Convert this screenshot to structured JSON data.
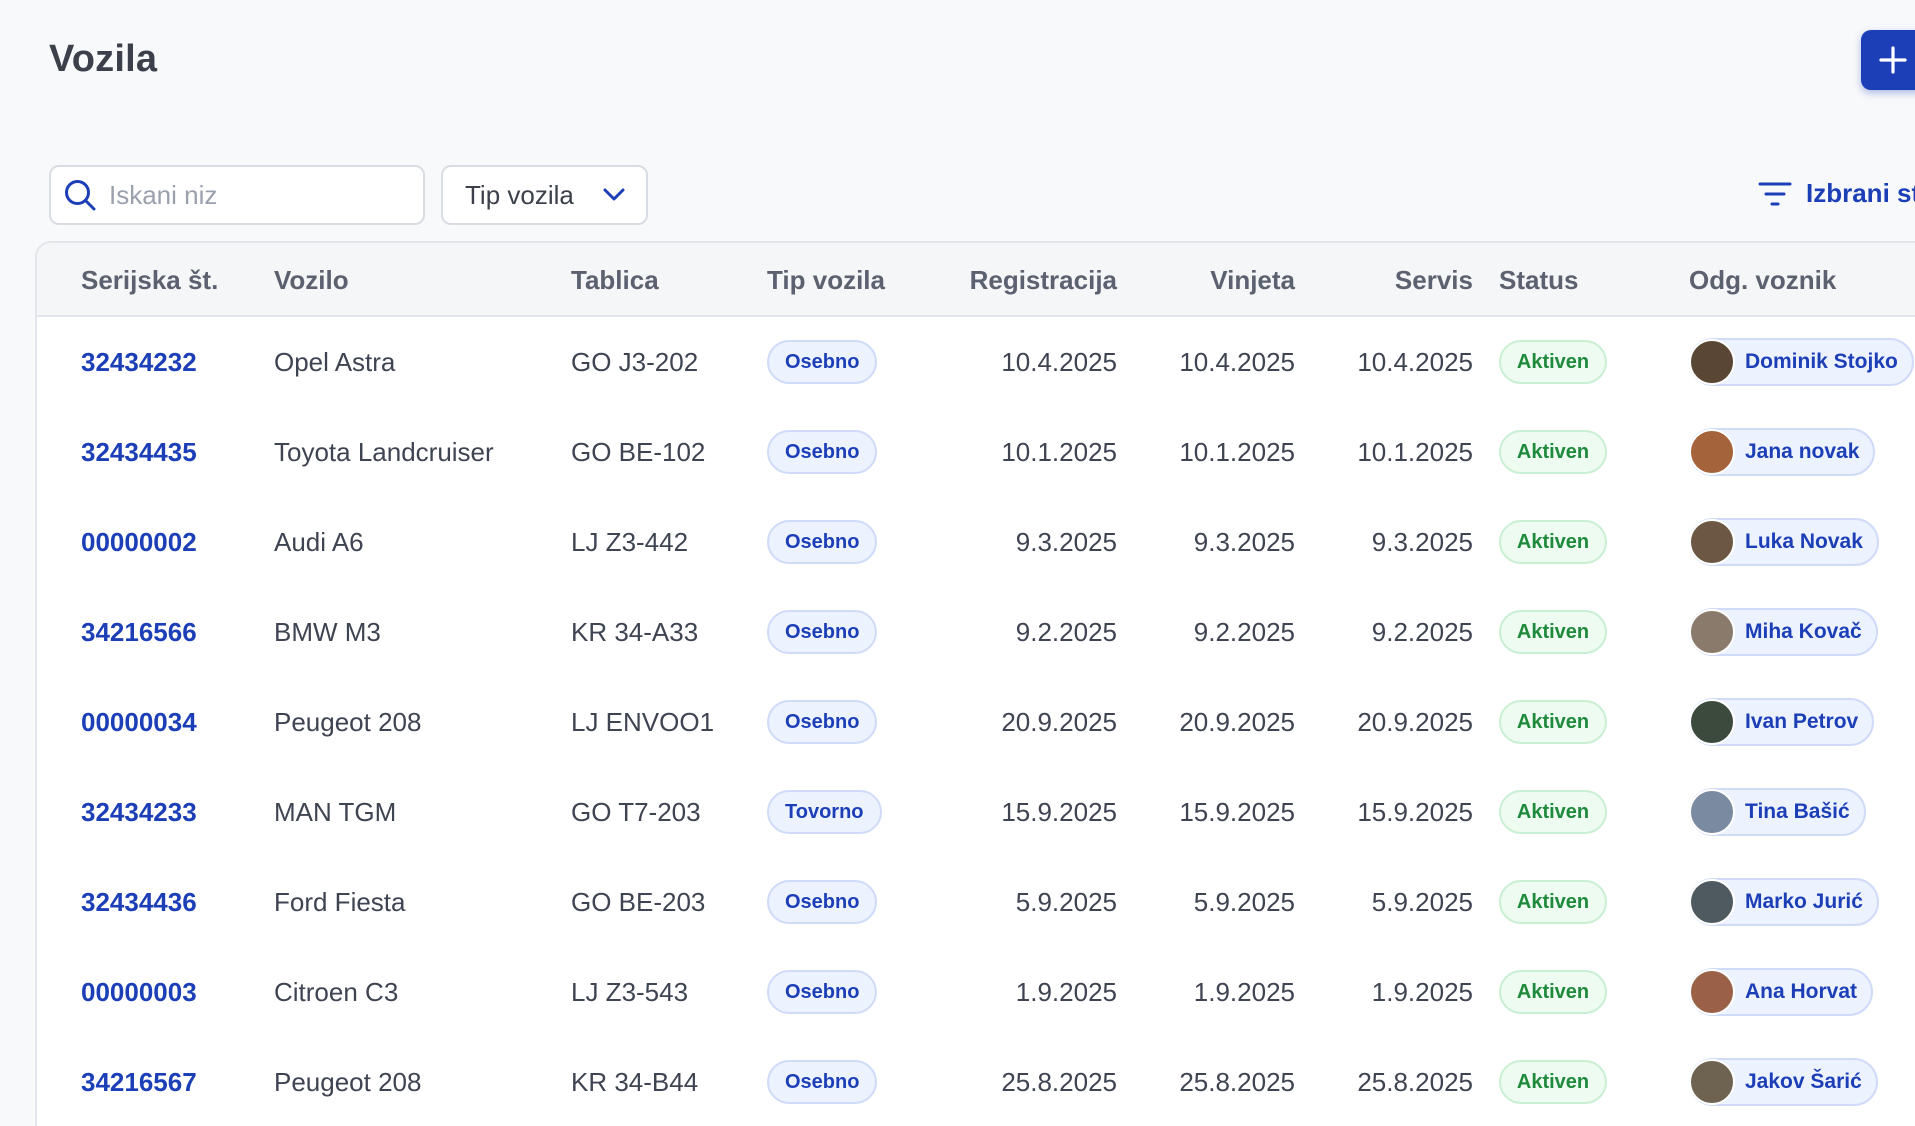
{
  "header": {
    "title": "Vozila",
    "add_button_icon": "plus-icon"
  },
  "toolbar": {
    "search_placeholder": "Iskani niz",
    "search_value": "",
    "type_filter_label": "Tip vozila",
    "columns_label": "Izbrani st"
  },
  "table": {
    "columns": {
      "serial": "Serijska št.",
      "vehicle": "Vozilo",
      "plate": "Tablica",
      "type": "Tip vozila",
      "registration": "Registracija",
      "vignette": "Vinjeta",
      "service": "Servis",
      "status": "Status",
      "driver": "Odg. voznik"
    },
    "rows": [
      {
        "serial": "32434232",
        "vehicle": "Opel Astra",
        "plate": "GO J3-202",
        "type": "Osebno",
        "registration": "10.4.2025",
        "vignette": "10.4.2025",
        "service": "10.4.2025",
        "status": "Aktiven",
        "driver": "Dominik Stojko",
        "avatar_color": "#5a4634"
      },
      {
        "serial": "32434435",
        "vehicle": "Toyota Landcruiser",
        "plate": "GO BE-102",
        "type": "Osebno",
        "registration": "10.1.2025",
        "vignette": "10.1.2025",
        "service": "10.1.2025",
        "status": "Aktiven",
        "driver": "Jana novak",
        "avatar_color": "#a5633c"
      },
      {
        "serial": "00000002",
        "vehicle": "Audi A6",
        "plate": "LJ Z3-442",
        "type": "Osebno",
        "registration": "9.3.2025",
        "vignette": "9.3.2025",
        "service": "9.3.2025",
        "status": "Aktiven",
        "driver": "Luka Novak",
        "avatar_color": "#6b5744"
      },
      {
        "serial": "34216566",
        "vehicle": "BMW M3",
        "plate": "KR 34-A33",
        "type": "Osebno",
        "registration": "9.2.2025",
        "vignette": "9.2.2025",
        "service": "9.2.2025",
        "status": "Aktiven",
        "driver": "Miha Kovač",
        "avatar_color": "#8a7a6c"
      },
      {
        "serial": "00000034",
        "vehicle": "Peugeot 208",
        "plate": "LJ ENVOO1",
        "type": "Osebno",
        "registration": "20.9.2025",
        "vignette": "20.9.2025",
        "service": "20.9.2025",
        "status": "Aktiven",
        "driver": "Ivan Petrov",
        "avatar_color": "#3c4a3e"
      },
      {
        "serial": "32434233",
        "vehicle": "MAN TGM",
        "plate": "GO T7-203",
        "type": "Tovorno",
        "registration": "15.9.2025",
        "vignette": "15.9.2025",
        "service": "15.9.2025",
        "status": "Aktiven",
        "driver": "Tina Bašić",
        "avatar_color": "#7a8aa0"
      },
      {
        "serial": "32434436",
        "vehicle": "Ford Fiesta",
        "plate": "GO BE-203",
        "type": "Osebno",
        "registration": "5.9.2025",
        "vignette": "5.9.2025",
        "service": "5.9.2025",
        "status": "Aktiven",
        "driver": "Marko Jurić",
        "avatar_color": "#4f5a60"
      },
      {
        "serial": "00000003",
        "vehicle": "Citroen C3",
        "plate": "LJ Z3-543",
        "type": "Osebno",
        "registration": "1.9.2025",
        "vignette": "1.9.2025",
        "service": "1.9.2025",
        "status": "Aktiven",
        "driver": "Ana Horvat",
        "avatar_color": "#9b6048"
      },
      {
        "serial": "34216567",
        "vehicle": "Peugeot 208",
        "plate": "KR 34-B44",
        "type": "Osebno",
        "registration": "25.8.2025",
        "vignette": "25.8.2025",
        "service": "25.8.2025",
        "status": "Aktiven",
        "driver": "Jakov Šarić",
        "avatar_color": "#6e6250"
      }
    ]
  },
  "colors": {
    "accent": "#1c3fb7",
    "status_green": "#1f8a3c",
    "badge_blue_bg": "#edf2ff",
    "status_green_bg": "#eefbf1"
  }
}
